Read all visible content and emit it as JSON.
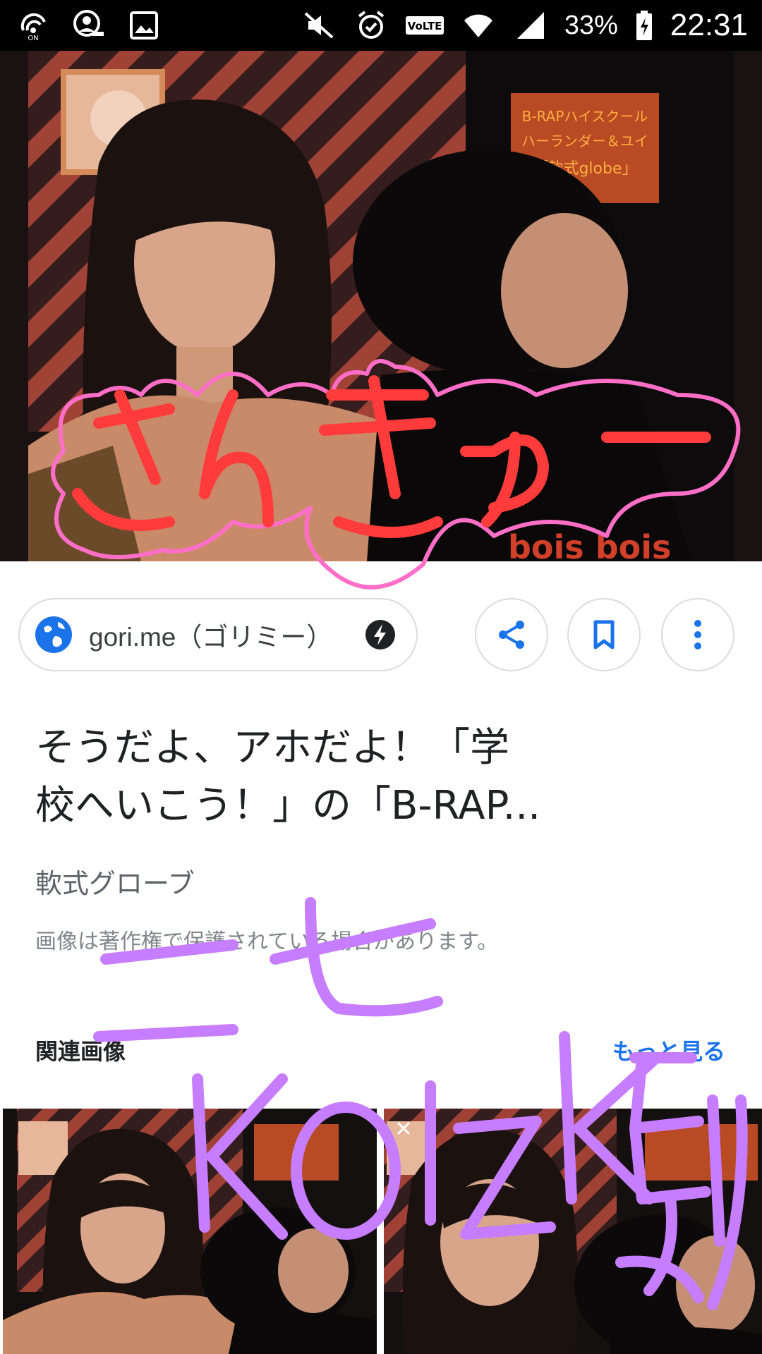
{
  "status_bar": {
    "battery_text": "33%",
    "time": "22:31",
    "left_icons": [
      "wifi-calling-icon",
      "account-key-icon",
      "gallery-icon"
    ],
    "right_icons": [
      "mute-icon",
      "alarm-icon",
      "volte-icon",
      "wifi-icon",
      "signal-icon",
      "battery-icon"
    ],
    "volte_label": "VoLTE"
  },
  "hero": {
    "caption_lines": [
      "B-RAPハイスクール",
      "ハーランダー＆ユイ",
      "「軟式globe」"
    ],
    "shirt_text": "bois bois"
  },
  "source": {
    "site": "gori.me（ゴリミー）",
    "icon": "globe-icon",
    "amp_icon": "amp-lightning-icon"
  },
  "actions": {
    "share_icon": "share-icon",
    "bookmark_icon": "bookmark-icon",
    "more_icon": "more-vert-icon"
  },
  "result": {
    "title_line1": "そうだよ、アホだよ！「学",
    "title_line2": "校へいこう！」の「B-RAP...",
    "subtitle": "軟式グローブ",
    "copyright": "画像は著作権で保護されている場合があります。"
  },
  "related": {
    "heading": "関連画像",
    "more_label": "もっと見る"
  },
  "handwriting": {
    "pink_text": "さんきゅー",
    "purple_line1": "ニセ",
    "purple_line2": "KOIZKEより"
  },
  "colors": {
    "accent_blue": "#1a73e8",
    "handwriting_red": "#ff3b3b",
    "handwriting_pink": "#ff6ec7",
    "handwriting_purple": "#c77dff"
  }
}
